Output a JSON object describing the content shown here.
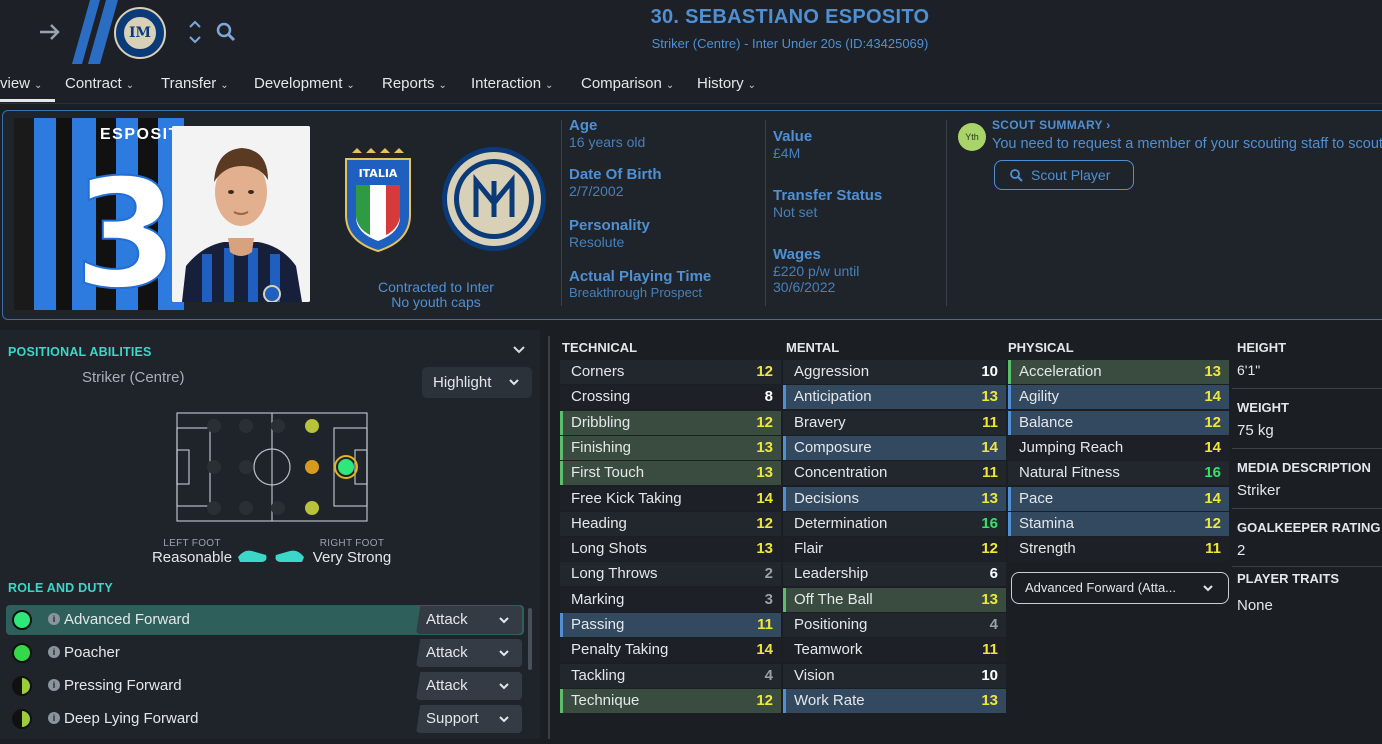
{
  "header": {
    "title": "30. SEBASTIANO ESPOSITO",
    "subtitle": "Striker (Centre) - Inter Under 20s (ID:43425069)"
  },
  "nav": {
    "tabs": [
      {
        "label": "view"
      },
      {
        "label": "Contract"
      },
      {
        "label": "Transfer"
      },
      {
        "label": "Development"
      },
      {
        "label": "Reports"
      },
      {
        "label": "Interaction"
      },
      {
        "label": "Comparison"
      },
      {
        "label": "History"
      }
    ]
  },
  "profile": {
    "kit_name": "ESPOSITO",
    "kit_number": "30",
    "contract_line1": "Contracted to Inter",
    "contract_line2": "No youth caps",
    "age_label": "Age",
    "age_value": "16 years old",
    "dob_label": "Date Of Birth",
    "dob_value": "2/7/2002",
    "personality_label": "Personality",
    "personality_value": "Resolute",
    "apt_label": "Actual Playing Time",
    "apt_value": "Breakthrough Prospect",
    "value_label": "Value",
    "value_value": "£4M",
    "transfer_label": "Transfer Status",
    "transfer_value": "Not set",
    "wages_label": "Wages",
    "wages_value1": "£220 p/w until",
    "wages_value2": "30/6/2022"
  },
  "scout": {
    "badge": "Yth",
    "title": "SCOUT SUMMARY",
    "text": "You need to request a member of your scouting staff to scout",
    "button": "Scout Player"
  },
  "positional": {
    "title": "POSITIONAL ABILITIES",
    "position": "Striker (Centre)",
    "highlight": "Highlight",
    "left_foot_label": "LEFT FOOT",
    "left_foot_value": "Reasonable",
    "right_foot_label": "RIGHT FOOT",
    "right_foot_value": "Very Strong"
  },
  "roles": {
    "title": "ROLE AND DUTY",
    "items": [
      {
        "name": "Advanced Forward",
        "duty": "Attack",
        "color": "#2ee87a"
      },
      {
        "name": "Poacher",
        "duty": "Attack",
        "color": "#35d84a"
      },
      {
        "name": "Pressing Forward",
        "duty": "Attack",
        "color": "#9ccc3a"
      },
      {
        "name": "Deep Lying Forward",
        "duty": "Support",
        "color": "#9ccc3a"
      }
    ]
  },
  "attributes": {
    "technical_title": "TECHNICAL",
    "mental_title": "MENTAL",
    "physical_title": "PHYSICAL",
    "technical": [
      {
        "name": "Corners",
        "value": "12",
        "hl": "none"
      },
      {
        "name": "Crossing",
        "value": "8",
        "hl": "none"
      },
      {
        "name": "Dribbling",
        "value": "12",
        "hl": "green"
      },
      {
        "name": "Finishing",
        "value": "13",
        "hl": "green"
      },
      {
        "name": "First Touch",
        "value": "13",
        "hl": "green"
      },
      {
        "name": "Free Kick Taking",
        "value": "14",
        "hl": "none"
      },
      {
        "name": "Heading",
        "value": "12",
        "hl": "none"
      },
      {
        "name": "Long Shots",
        "value": "13",
        "hl": "none"
      },
      {
        "name": "Long Throws",
        "value": "2",
        "hl": "none"
      },
      {
        "name": "Marking",
        "value": "3",
        "hl": "none"
      },
      {
        "name": "Passing",
        "value": "11",
        "hl": "blue"
      },
      {
        "name": "Penalty Taking",
        "value": "14",
        "hl": "none"
      },
      {
        "name": "Tackling",
        "value": "4",
        "hl": "none"
      },
      {
        "name": "Technique",
        "value": "12",
        "hl": "green"
      }
    ],
    "mental": [
      {
        "name": "Aggression",
        "value": "10",
        "hl": "none"
      },
      {
        "name": "Anticipation",
        "value": "13",
        "hl": "blue"
      },
      {
        "name": "Bravery",
        "value": "11",
        "hl": "none"
      },
      {
        "name": "Composure",
        "value": "14",
        "hl": "blue"
      },
      {
        "name": "Concentration",
        "value": "11",
        "hl": "none"
      },
      {
        "name": "Decisions",
        "value": "13",
        "hl": "blue"
      },
      {
        "name": "Determination",
        "value": "16",
        "hl": "none"
      },
      {
        "name": "Flair",
        "value": "12",
        "hl": "none"
      },
      {
        "name": "Leadership",
        "value": "6",
        "hl": "none"
      },
      {
        "name": "Off The Ball",
        "value": "13",
        "hl": "green"
      },
      {
        "name": "Positioning",
        "value": "4",
        "hl": "none"
      },
      {
        "name": "Teamwork",
        "value": "11",
        "hl": "none"
      },
      {
        "name": "Vision",
        "value": "10",
        "hl": "none"
      },
      {
        "name": "Work Rate",
        "value": "13",
        "hl": "blue"
      }
    ],
    "physical": [
      {
        "name": "Acceleration",
        "value": "13",
        "hl": "green"
      },
      {
        "name": "Agility",
        "value": "14",
        "hl": "blue"
      },
      {
        "name": "Balance",
        "value": "12",
        "hl": "blue"
      },
      {
        "name": "Jumping Reach",
        "value": "14",
        "hl": "none"
      },
      {
        "name": "Natural Fitness",
        "value": "16",
        "hl": "none"
      },
      {
        "name": "Pace",
        "value": "14",
        "hl": "blue"
      },
      {
        "name": "Stamina",
        "value": "12",
        "hl": "blue"
      },
      {
        "name": "Strength",
        "value": "11",
        "hl": "none"
      }
    ],
    "role_select": "Advanced Forward (Atta..."
  },
  "side": {
    "height_label": "HEIGHT",
    "height_value": "6'1\"",
    "weight_label": "WEIGHT",
    "weight_value": "75 kg",
    "media_label": "MEDIA DESCRIPTION",
    "media_value": "Striker",
    "gk_label": "GOALKEEPER RATING",
    "gk_value": "2",
    "traits_label": "PLAYER TRAITS",
    "traits_value": "None"
  },
  "colors": {
    "accent": "#4f90d4",
    "section": "#3bd7c8",
    "value_white": "#ffffff",
    "value_yellow": "#f0e63a",
    "value_green": "#37e06a",
    "value_grey": "#9aa1a9"
  }
}
